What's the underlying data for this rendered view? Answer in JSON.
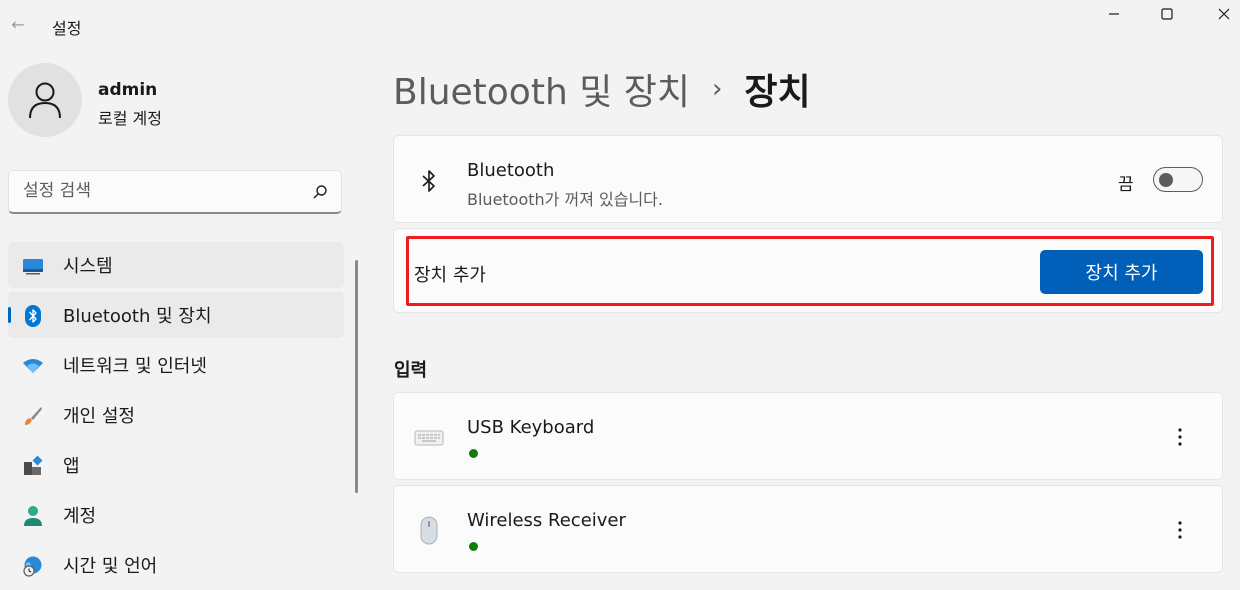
{
  "window": {
    "title": "설정",
    "back_glyph": "←"
  },
  "profile": {
    "name": "admin",
    "account_type": "로컬 계정"
  },
  "search": {
    "placeholder": "설정 검색"
  },
  "sidebar": {
    "items": [
      {
        "label": "시스템",
        "icon": "system-monitor-icon",
        "state": "hover"
      },
      {
        "label": "Bluetooth 및 장치",
        "icon": "bluetooth-icon",
        "state": "active"
      },
      {
        "label": "네트워크 및 인터넷",
        "icon": "wifi-icon",
        "state": "normal"
      },
      {
        "label": "개인 설정",
        "icon": "paintbrush-icon",
        "state": "normal"
      },
      {
        "label": "앱",
        "icon": "apps-icon",
        "state": "normal"
      },
      {
        "label": "계정",
        "icon": "account-icon",
        "state": "normal"
      },
      {
        "label": "시간 및 언어",
        "icon": "globe-clock-icon",
        "state": "normal"
      }
    ]
  },
  "breadcrumb": {
    "parent": "Bluetooth 및 장치",
    "separator": "›",
    "current": "장치"
  },
  "bluetooth_card": {
    "title": "Bluetooth",
    "subtitle": "Bluetooth가 꺼져 있습니다.",
    "toggle_label": "끔",
    "toggle_on": false
  },
  "add_device_card": {
    "label": "장치 추가",
    "button_label": "장치 추가"
  },
  "input_section": {
    "title": "입력",
    "devices": [
      {
        "name": "USB Keyboard",
        "icon": "keyboard-icon",
        "status_color": "#107c10"
      },
      {
        "name": "Wireless Receiver",
        "icon": "mouse-icon",
        "status_color": "#107c10"
      }
    ]
  },
  "colors": {
    "accent": "#005fb8",
    "highlight": "#ee1c1c",
    "status_connected": "#107c10"
  }
}
